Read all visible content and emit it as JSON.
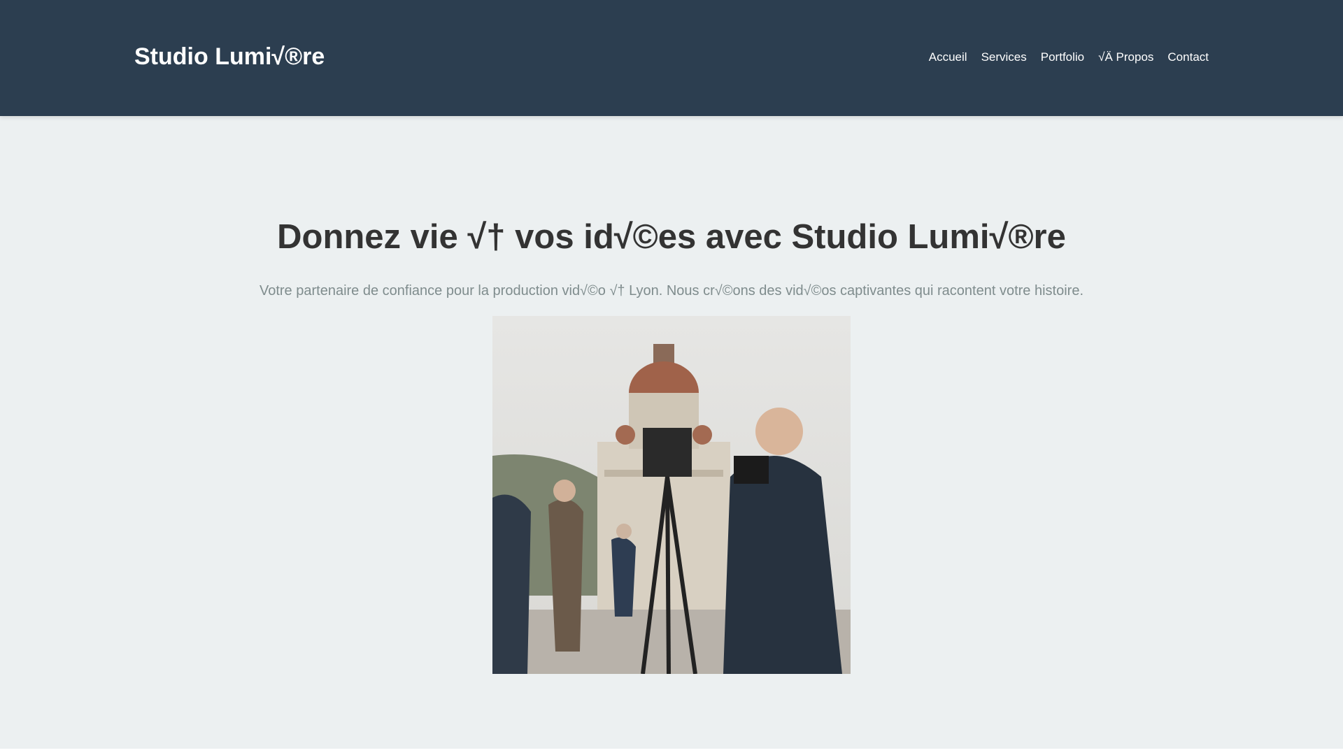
{
  "header": {
    "logo": "Studio Lumi√®re",
    "nav": [
      "Accueil",
      "Services",
      "Portfolio",
      "√Ä Propos",
      "Contact"
    ]
  },
  "hero": {
    "title": "Donnez vie √† vos id√©es avec Studio Lumi√®re",
    "subtitle": "Votre partenaire de confiance pour la production vid√©o √† Lyon. Nous cr√©ons des vid√©os captivantes qui racontent votre histoire."
  },
  "colors": {
    "header_bg": "#2c3e50",
    "page_bg": "#ecf0f1",
    "title": "#333333",
    "subtitle": "#7f8c8d"
  }
}
